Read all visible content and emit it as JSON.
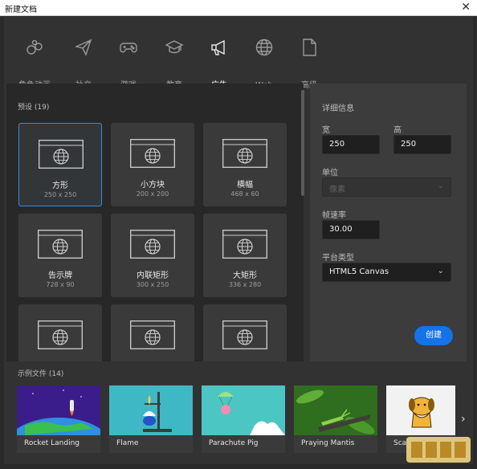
{
  "window": {
    "title": "新建文档",
    "close_glyph": "✕"
  },
  "categories": [
    {
      "label": "角色动画",
      "icon": "character-animation-icon",
      "active": false
    },
    {
      "label": "社交",
      "icon": "paper-plane-icon",
      "active": false
    },
    {
      "label": "游戏",
      "icon": "gamepad-icon",
      "active": false
    },
    {
      "label": "教育",
      "icon": "graduation-cap-icon",
      "active": false
    },
    {
      "label": "广告",
      "icon": "megaphone-icon",
      "active": true
    },
    {
      "label": "Web",
      "icon": "globe-icon",
      "active": false
    },
    {
      "label": "高级",
      "icon": "document-icon",
      "active": false
    }
  ],
  "presets": {
    "title": "预设 (19)",
    "items": [
      {
        "name": "方形",
        "dims": "250 x 250",
        "selected": true
      },
      {
        "name": "小方块",
        "dims": "200 x 200",
        "selected": false
      },
      {
        "name": "横幅",
        "dims": "468 x 60",
        "selected": false
      },
      {
        "name": "告示牌",
        "dims": "728 x 90",
        "selected": false
      },
      {
        "name": "内联矩形",
        "dims": "300 x 250",
        "selected": false
      },
      {
        "name": "大矩形",
        "dims": "336 x 280",
        "selected": false
      },
      {
        "name": "",
        "dims": "",
        "selected": false
      },
      {
        "name": "",
        "dims": "",
        "selected": false
      },
      {
        "name": "",
        "dims": "",
        "selected": false
      }
    ]
  },
  "details": {
    "title": "详细信息",
    "width_label": "宽",
    "width_value": "250",
    "height_label": "高",
    "height_value": "250",
    "unit_label": "单位",
    "unit_value": "像素",
    "framerate_label": "帧速率",
    "framerate_value": "30.00",
    "platform_label": "平台类型",
    "platform_value": "HTML5 Canvas",
    "create_label": "创建"
  },
  "samples": {
    "title": "示例文件 (14)",
    "items": [
      {
        "name": "Rocket Landing"
      },
      {
        "name": "Flame"
      },
      {
        "name": "Parachute Pig"
      },
      {
        "name": "Praying Mantis"
      },
      {
        "name": "Sca"
      }
    ],
    "next_glyph": "›"
  },
  "colors": {
    "accent": "#1473e6",
    "selected_border": "#3d8ad9",
    "background": "#323232"
  }
}
